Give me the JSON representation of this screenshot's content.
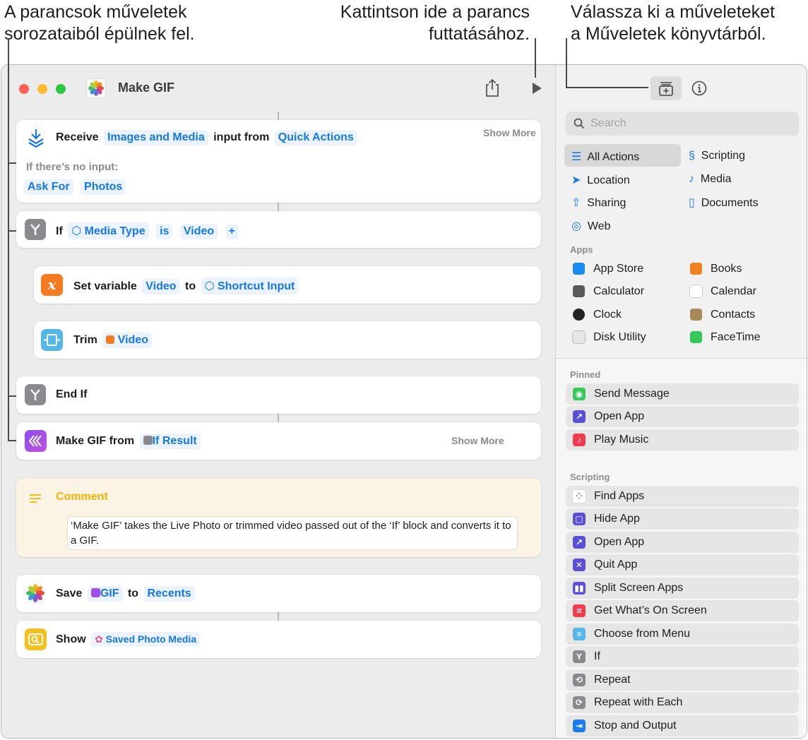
{
  "callouts": {
    "left_line1": "A parancsok műveletek",
    "left_line2": "sorozataiból épülnek fel.",
    "mid_line1": "Kattintson ide a parancs",
    "mid_line2": "futtatásához.",
    "right_line1": "Válassza ki a műveleteket",
    "right_line2": "a Műveletek könyvtárból."
  },
  "window": {
    "title": "Make GIF"
  },
  "actions": {
    "receive": {
      "word": "Receive",
      "type_token": "Images and Media",
      "mid": "input from",
      "source_token": "Quick Actions",
      "show_more": "Show More",
      "no_input_label": "If there’s no input:",
      "ask_token": "Ask For",
      "photos_token": "Photos"
    },
    "if_block": {
      "word": "If",
      "var_token": "Media Type",
      "is_token": "is",
      "value_token": "Video",
      "plus": "+"
    },
    "set_variable": {
      "word": "Set variable",
      "var_token": "Video",
      "mid": "to",
      "value_token": "Shortcut Input"
    },
    "trim": {
      "word": "Trim",
      "token": "Video"
    },
    "end_if": {
      "word": "End If"
    },
    "make_gif": {
      "word": "Make GIF from",
      "token": "If Result",
      "show_more": "Show More"
    },
    "comment": {
      "title": "Comment",
      "text": "‘Make GIF’ takes the Live Photo or trimmed video passed out of the ‘If’ block and converts it to a GIF."
    },
    "save": {
      "word": "Save",
      "token": "GIF",
      "mid": "to",
      "dest_token": "Recents"
    },
    "show": {
      "word": "Show",
      "token": "Saved Photo Media"
    }
  },
  "sidebar": {
    "search_placeholder": "Search",
    "categories": [
      "All Actions",
      "Scripting",
      "Location",
      "Media",
      "Sharing",
      "Documents",
      "Web"
    ],
    "apps_label": "Apps",
    "apps": [
      "App Store",
      "Books",
      "Calculator",
      "Calendar",
      "Clock",
      "Contacts",
      "Disk Utility",
      "FaceTime"
    ],
    "pinned_label": "Pinned",
    "pinned": [
      "Send Message",
      "Open App",
      "Play Music"
    ],
    "scripting_label": "Scripting",
    "scripting": [
      "Find Apps",
      "Hide App",
      "Open App",
      "Quit App",
      "Split Screen Apps",
      "Get What’s On Screen",
      "Choose from Menu",
      "If",
      "Repeat",
      "Repeat with Each",
      "Stop and Output"
    ]
  },
  "colors": {
    "accent": "#1677e6",
    "token_bg": "#eaf3ff",
    "comment_bg": "#fbf4e4",
    "comment_title": "#f2b300"
  }
}
